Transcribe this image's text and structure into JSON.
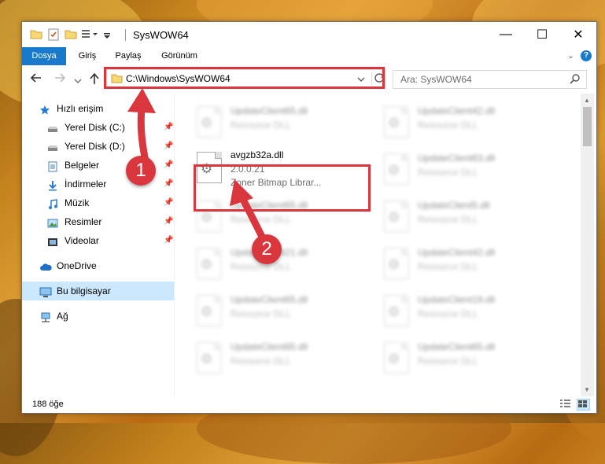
{
  "window": {
    "title": "SysWOW64"
  },
  "titlebar": {
    "minimize": "—",
    "maximize": "☐",
    "close": "✕"
  },
  "ribbon": {
    "tabs": [
      "Dosya",
      "Giriş",
      "Paylaş",
      "Görünüm"
    ],
    "help": "?"
  },
  "address": {
    "path": "C:\\Windows\\SysWOW64"
  },
  "search": {
    "placeholder": "Ara: SysWOW64"
  },
  "sidebar": {
    "quick_access": "Hızlı erişim",
    "items": [
      "Yerel Disk (C:)",
      "Yerel Disk (D:)",
      "Belgeler",
      "İndirmeler",
      "Müzik",
      "Resimler",
      "Videolar"
    ],
    "onedrive": "OneDrive",
    "this_pc": "Bu bilgisayar",
    "network": "Ağ"
  },
  "files": {
    "selected": {
      "name": "avgzb32a.dll",
      "version": "2.0.0.21",
      "description": "Zoner Bitmap Librar..."
    },
    "col_left": [
      {
        "name": "UpdateClient65.dll",
        "desc": "Resource DLL"
      },
      {
        "name": "UpdateClient65.dll",
        "desc": "Resource DLL"
      },
      {
        "name": "UpdateClient21.dll",
        "desc": "Resource DLL"
      },
      {
        "name": "UpdateClient65.dll",
        "desc": "Resource DLL"
      },
      {
        "name": "UpdateClient65.dll",
        "desc": "Resource DLL"
      }
    ],
    "col_right": [
      {
        "name": "UpdateClient42.dll",
        "desc": "Resource DLL"
      },
      {
        "name": "UpdateClient63.dll",
        "desc": "Resource DLL"
      },
      {
        "name": "UpdateClient5.dll",
        "desc": "Resource DLL"
      },
      {
        "name": "UpdateClient42.dll",
        "desc": "Resource DLL"
      },
      {
        "name": "UpdateClient19.dll",
        "desc": "Resource DLL"
      },
      {
        "name": "UpdateClient65.dll",
        "desc": "Resource DLL"
      }
    ]
  },
  "status": {
    "count": "188 öğe"
  },
  "annotations": {
    "step1": "1",
    "step2": "2",
    "color": "#d9363e"
  }
}
